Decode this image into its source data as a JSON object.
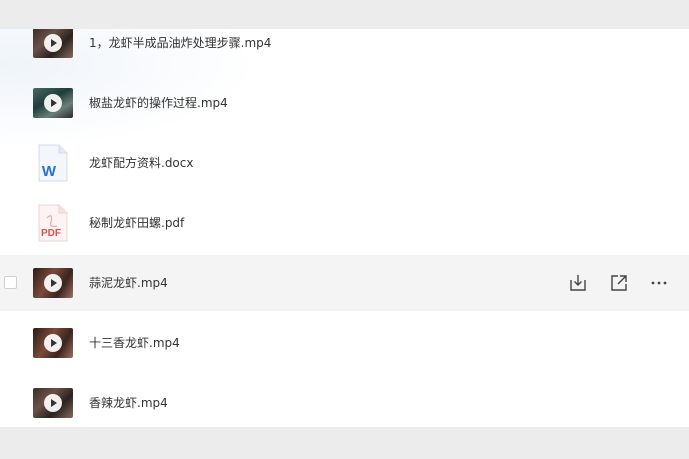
{
  "files": [
    {
      "name": "1，龙虾半成品油炸处理步骤.mp4",
      "type": "video"
    },
    {
      "name": "椒盐龙虾的操作过程.mp4",
      "type": "video"
    },
    {
      "name": "龙虾配方资料.docx",
      "type": "word"
    },
    {
      "name": "秘制龙虾田螺.pdf",
      "type": "pdf"
    },
    {
      "name": "蒜泥龙虾.mp4",
      "type": "video",
      "hovered": true
    },
    {
      "name": "十三香龙虾.mp4",
      "type": "video"
    },
    {
      "name": "香辣龙虾.mp4",
      "type": "video"
    }
  ],
  "word_icon_letter": "W",
  "pdf_icon_label": "PDF",
  "row_actions": [
    "download-icon",
    "share-icon",
    "more-icon"
  ],
  "colors": {
    "word": "#2b6fd6",
    "pdf": "#d9534f",
    "hover_row": "#f4f4f5"
  }
}
